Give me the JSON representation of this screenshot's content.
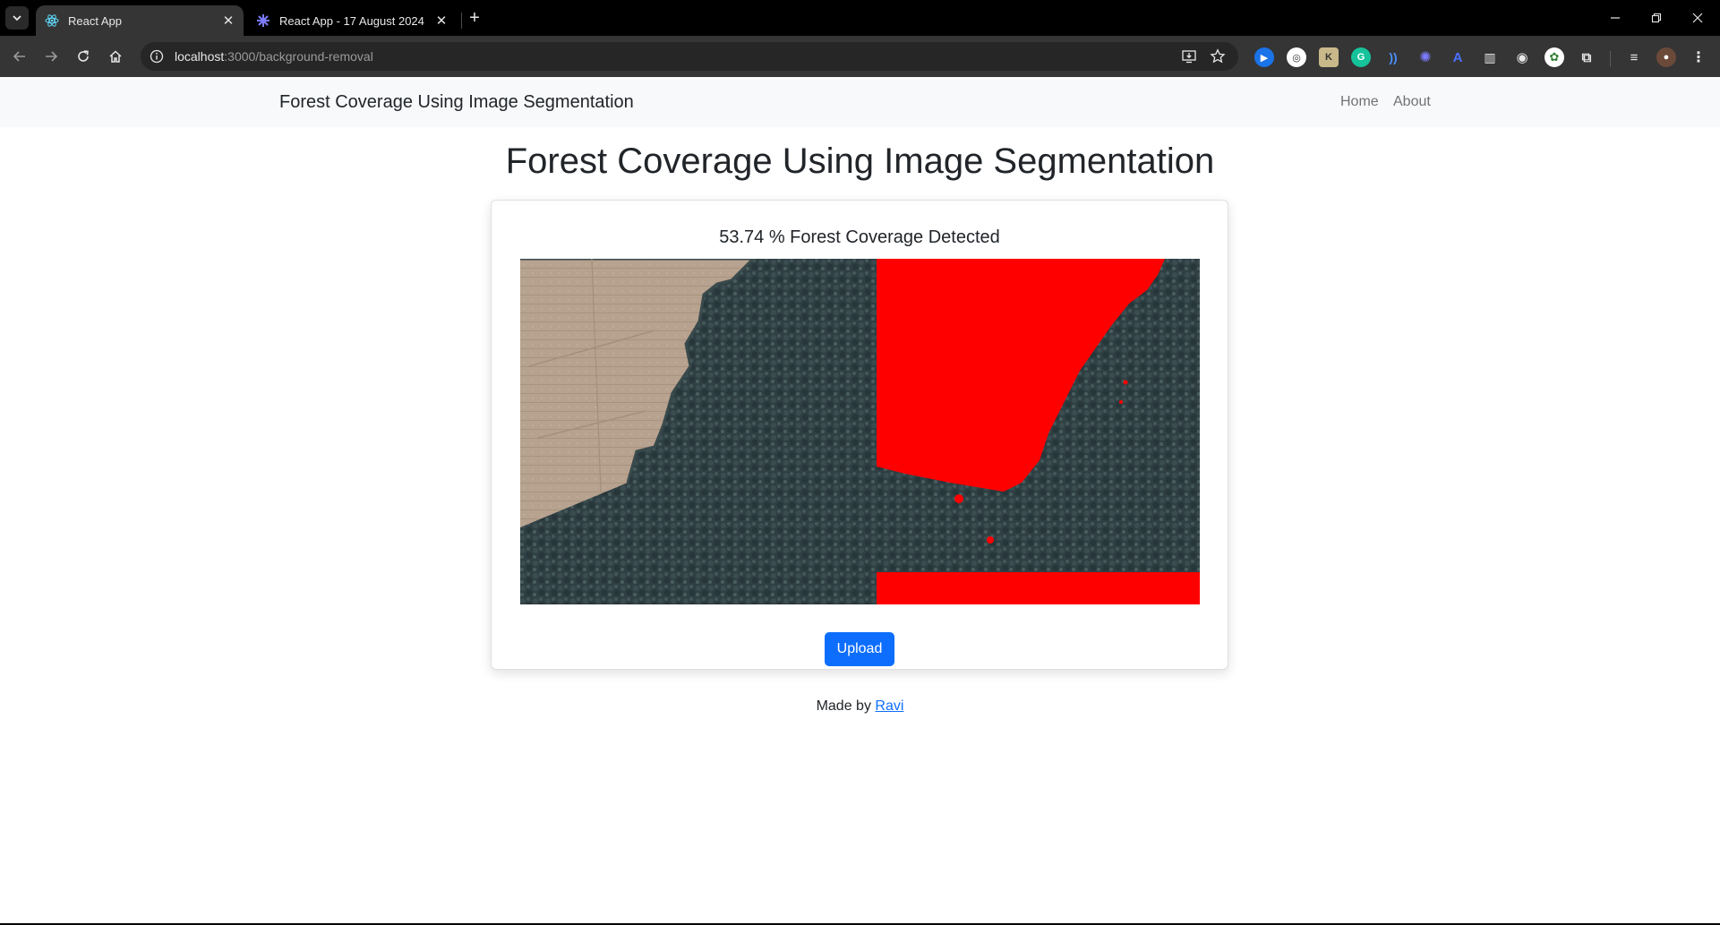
{
  "browser": {
    "tabs": [
      {
        "label": "React App",
        "active": true
      },
      {
        "label": "React App - 17 August 2024",
        "active": false
      }
    ],
    "url_host": "localhost",
    "url_rest": ":3000/background-removal"
  },
  "navbar": {
    "brand": "Forest Coverage Using Image Segmentation",
    "links": [
      {
        "label": "Home"
      },
      {
        "label": "About"
      }
    ]
  },
  "main": {
    "title": "Forest Coverage Using Image Segmentation",
    "result_title": "53.74 % Forest Coverage Detected",
    "coverage_percent": 53.74,
    "upload_label": "Upload"
  },
  "footer": {
    "made_by": "Made by",
    "author": "Ravi"
  },
  "colors": {
    "mask": "#ff0000",
    "primary": "#0d6efd",
    "navbar_bg": "#f8f9fa",
    "chrome_bg": "#353535",
    "tabstrip_bg": "#000000"
  }
}
